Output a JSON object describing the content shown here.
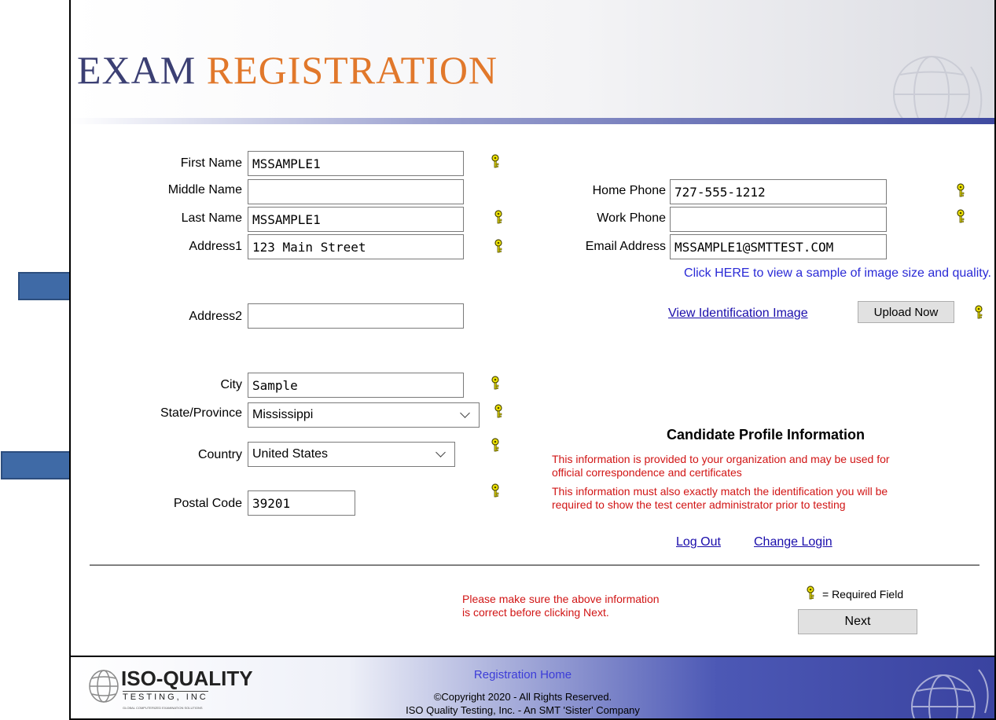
{
  "header": {
    "title_part1": "EXAM",
    "title_part2": "REGISTRATION"
  },
  "form": {
    "first_name_label": "First Name",
    "first_name_value": "MSSAMPLE1",
    "middle_name_label": "Middle Name",
    "middle_name_value": "",
    "last_name_label": "Last Name",
    "last_name_value": "MSSAMPLE1",
    "address1_label": "Address1",
    "address1_value": "123 Main Street",
    "address2_label": "Address2",
    "address2_value": "",
    "city_label": "City",
    "city_value": "Sample",
    "state_label": "State/Province",
    "state_value": "Mississippi",
    "country_label": "Country",
    "country_value": "United States",
    "postal_label": "Postal Code",
    "postal_value": "39201",
    "home_phone_label": "Home Phone",
    "home_phone_value": "727-555-1212",
    "work_phone_label": "Work Phone",
    "work_phone_value": "",
    "email_label": "Email Address",
    "email_value": "MSSAMPLE1@SMTTEST.COM"
  },
  "id_image": {
    "sample_text": "Click HERE to view a sample of image size and quality.",
    "view_link": "View Identification Image",
    "upload_button": "Upload Now"
  },
  "profile": {
    "heading": "Candidate Profile Information",
    "note1": "This information is provided to your organization and may be used for",
    "note2": "official correspondence and certificates",
    "note3": "This information must also exactly match the identification you will be",
    "note4": "required to show the test center administrator prior to testing",
    "logout_link": "Log Out",
    "change_login_link": "Change Login"
  },
  "bottom": {
    "warning_line1": "Please make sure the above information",
    "warning_line2": "is correct before clicking Next.",
    "required_legend": "= Required Field",
    "next_button": "Next"
  },
  "footer": {
    "home_link": "Registration Home",
    "copyright": "©Copyright 2020 - All Rights Reserved.",
    "company": "ISO Quality Testing, Inc. - An SMT 'Sister' Company",
    "logo_main": "ISO-QUALITY",
    "logo_sub": "TESTING, INC",
    "logo_tagline": "GLOBAL COMPUTERIZED EXAMINATION SOLUTIONS"
  },
  "colors": {
    "title_blue": "#3b3f73",
    "title_orange": "#e1782b",
    "arrow_blue": "#3f6aa6",
    "note_red": "#d11515",
    "link_blue": "#1a0dab"
  },
  "icons": {
    "required": "key-icon",
    "annotation": "arrow-right-icon",
    "decor": "globe-icon"
  }
}
